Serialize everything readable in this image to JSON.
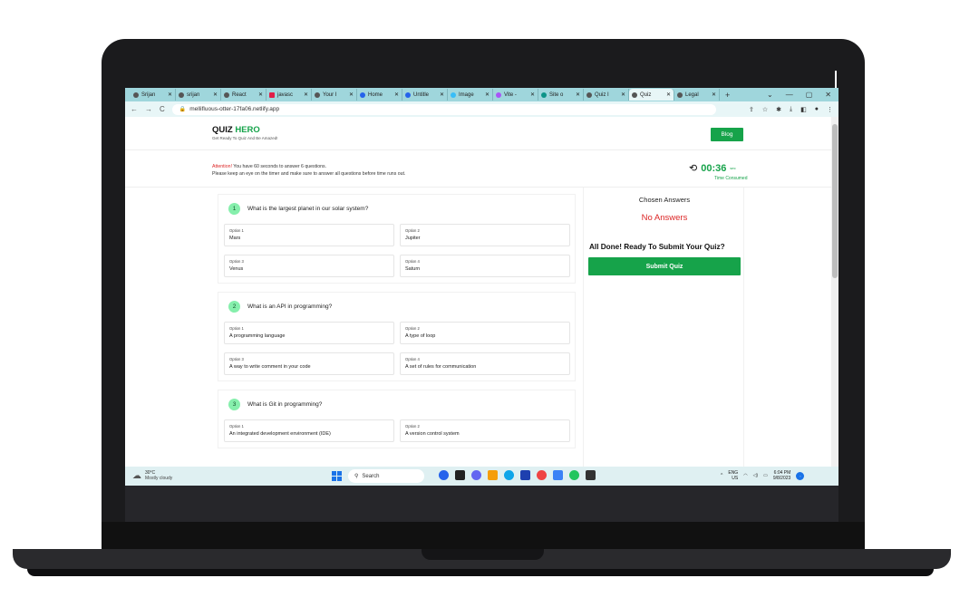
{
  "browser": {
    "tabs": [
      "Srijan",
      "srijan",
      "React",
      "javasc",
      "Your I",
      "Home",
      "Untitle",
      "Image",
      "Vite -",
      "Site o",
      "Quiz I",
      "Quiz",
      "Legal"
    ],
    "new_tab": "+",
    "win_controls": [
      "⌄",
      "—",
      "▢",
      "✕"
    ],
    "url": "mellifluous-otter-17fa06.netlify.app"
  },
  "header": {
    "logo_a": "QUIZ ",
    "logo_b": "HERO",
    "tagline": "Get Ready To Quiz And Be Amazed!",
    "blog_label": "Blog"
  },
  "notice": {
    "attention": "Attention!",
    "line1": " You have 60 seconds to answer 6 questions.",
    "line2": "Please keep an eye on the timer and make sure to answer all questions before time runs out."
  },
  "timer": {
    "value": "00:36",
    "unit": "sec",
    "label": "Time Consumed"
  },
  "questions": [
    {
      "num": "1",
      "text": "What is the largest planet in our solar system?",
      "options": [
        {
          "label": "Option 1",
          "text": "Mars"
        },
        {
          "label": "Option 2",
          "text": "Jupiter"
        },
        {
          "label": "Option 3",
          "text": "Venus"
        },
        {
          "label": "Option 4",
          "text": "Saturn"
        }
      ]
    },
    {
      "num": "2",
      "text": "What is an API in programming?",
      "options": [
        {
          "label": "Option 1",
          "text": "A programming language"
        },
        {
          "label": "Option 2",
          "text": "A type of loop"
        },
        {
          "label": "Option 3",
          "text": "A way to write comment in your code"
        },
        {
          "label": "Option 4",
          "text": "A set of rules for communication"
        }
      ]
    },
    {
      "num": "3",
      "text": "What is Git in programming?",
      "options": [
        {
          "label": "Option 1",
          "text": "An integrated development environment (IDE)"
        },
        {
          "label": "Option 2",
          "text": "A version control system"
        }
      ]
    }
  ],
  "sidebar": {
    "chosen_title": "Chosen Answers",
    "no_answers": "No Answers",
    "done_text": "All Done! Ready To Submit Your Quiz?",
    "submit_label": "Submit Quiz"
  },
  "taskbar": {
    "temp": "30°C",
    "weather": "Mostly cloudy",
    "search": "Search",
    "lang": "ENG",
    "region": "US",
    "time": "6:04 PM",
    "date": "9/8/2023"
  },
  "colors": {
    "accent": "#16a34a",
    "alert": "#dc2626",
    "tab_bar": "#9fd6dc"
  }
}
